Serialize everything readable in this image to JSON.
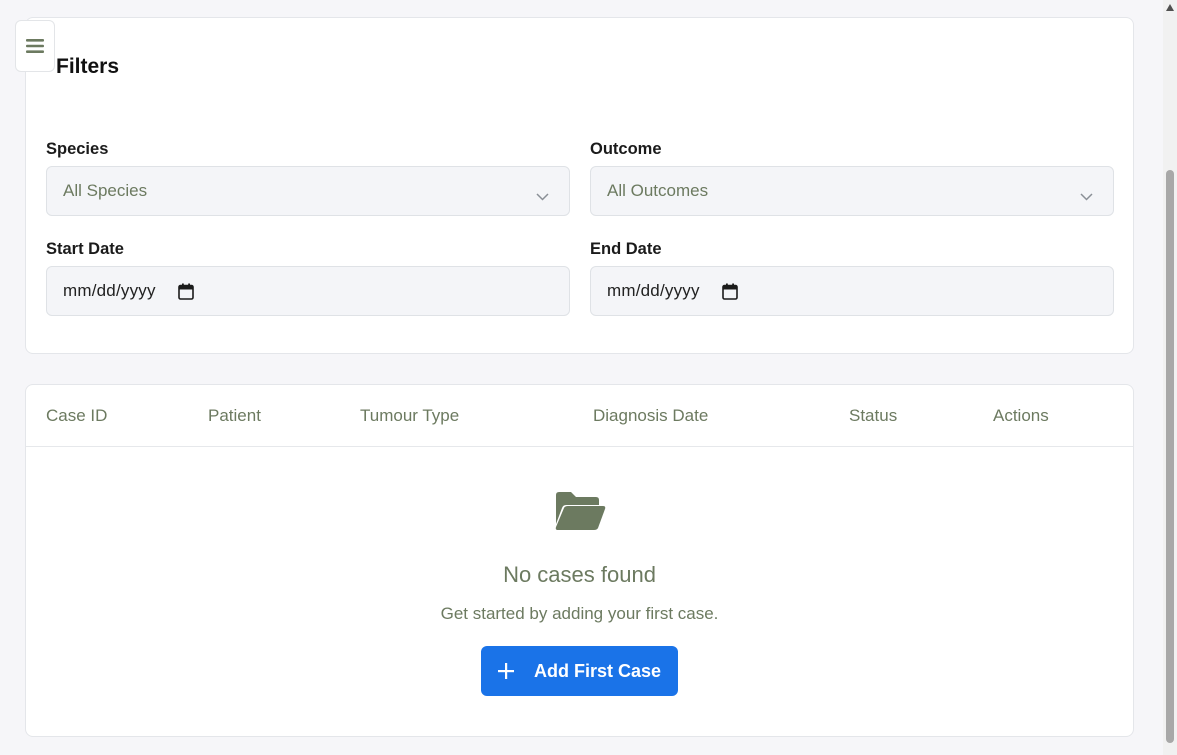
{
  "filters": {
    "title": "Filters",
    "species": {
      "label": "Species",
      "value": "All Species"
    },
    "outcome": {
      "label": "Outcome",
      "value": "All Outcomes"
    },
    "start_date": {
      "label": "Start Date",
      "value": "mm/dd/yyyy"
    },
    "end_date": {
      "label": "End Date",
      "value": "mm/dd/yyyy"
    }
  },
  "table": {
    "columns": [
      "Case ID",
      "Patient",
      "Tumour Type",
      "Diagnosis Date",
      "Status",
      "Actions"
    ],
    "empty": {
      "title": "No cases found",
      "subtitle": "Get started by adding your first case.",
      "button_label": "Add First Case"
    }
  },
  "icons": {
    "menu": "hamburger-icon",
    "dropdown": "chevron-down-icon",
    "calendar": "calendar-icon",
    "empty_state": "folder-open-icon",
    "add": "plus-icon"
  },
  "colors": {
    "accent": "#1a73e8",
    "muted_green": "#6c7a60",
    "page_bg": "#f6f6f9",
    "input_bg": "#f4f5f8"
  }
}
